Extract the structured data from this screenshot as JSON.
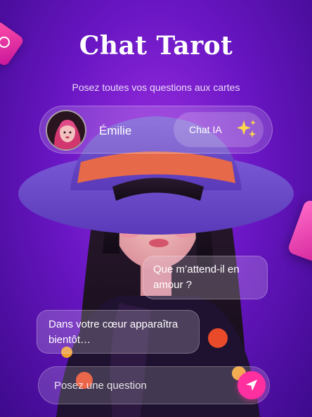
{
  "header": {
    "title": "Chat Tarot",
    "subtitle": "Posez toutes vos questions aux cartes"
  },
  "profile": {
    "name": "Émilie",
    "chat_label": "Chat IA",
    "sparkle_icon": "sparkles-icon"
  },
  "chat": {
    "question": "Que m’attend-il en amour ?",
    "answer": "Dans votre cœur apparaîtra bientôt…"
  },
  "input": {
    "placeholder": "Posez une question",
    "send_icon": "send-icon"
  },
  "colors": {
    "background": "#7a1fd0",
    "accent": "#ff2fa0",
    "sparkle": "#ffd84a"
  }
}
